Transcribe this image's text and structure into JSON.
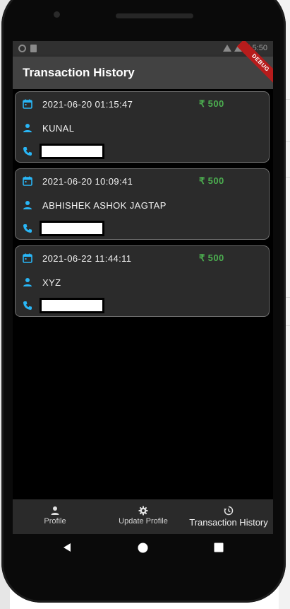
{
  "app": {
    "title": "Transaction History",
    "debug_label": "DEBUG"
  },
  "status_bar": {
    "time": "5:50"
  },
  "transactions": [
    {
      "datetime": "2021-06-20 01:15:47",
      "amount": "₹ 500",
      "name": "KUNAL"
    },
    {
      "datetime": "2021-06-20 10:09:41",
      "amount": "₹ 500",
      "name": "ABHISHEK ASHOK JAGTAP"
    },
    {
      "datetime": "2021-06-22 11:44:11",
      "amount": "₹ 500",
      "name": "XYZ"
    }
  ],
  "bottom_nav": {
    "items": [
      {
        "label": "Profile",
        "icon": "person-icon"
      },
      {
        "label": "Update Profile",
        "icon": "gear-icon"
      },
      {
        "label": "Transaction History",
        "icon": "history-icon",
        "active": true
      }
    ]
  },
  "colors": {
    "accent": "#29b6f6",
    "amount": "#4caf50",
    "app_bar": "#424242",
    "card": "#2b2b2b"
  }
}
